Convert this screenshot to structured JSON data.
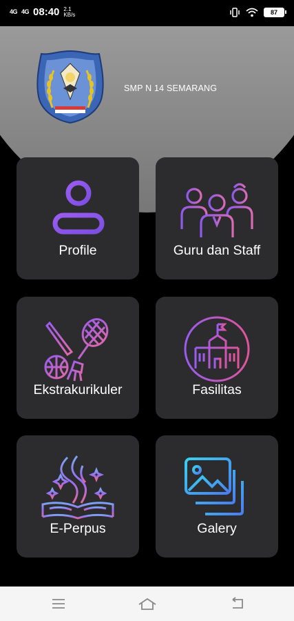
{
  "status_bar": {
    "signal1": "4G",
    "signal2": "4G",
    "time": "08:40",
    "speed_value": "2.1",
    "speed_unit": "KB/s",
    "battery": "87"
  },
  "header": {
    "school_name": "SMP N 14 SEMARANG"
  },
  "menu": [
    {
      "label": "Profile",
      "icon": "person-icon"
    },
    {
      "label": "Guru dan Staff",
      "icon": "group-icon"
    },
    {
      "label": "Ekstrakurikuler",
      "icon": "sports-icon"
    },
    {
      "label": "Fasilitas",
      "icon": "building-icon"
    },
    {
      "label": "E-Perpus",
      "icon": "book-icon"
    },
    {
      "label": "Galery",
      "icon": "gallery-icon"
    }
  ],
  "colors": {
    "card": "#2c2c2e",
    "accent_purple": "#9b5cf0",
    "accent_blue": "#4fb6f0",
    "accent_pink": "#d85fb8"
  }
}
